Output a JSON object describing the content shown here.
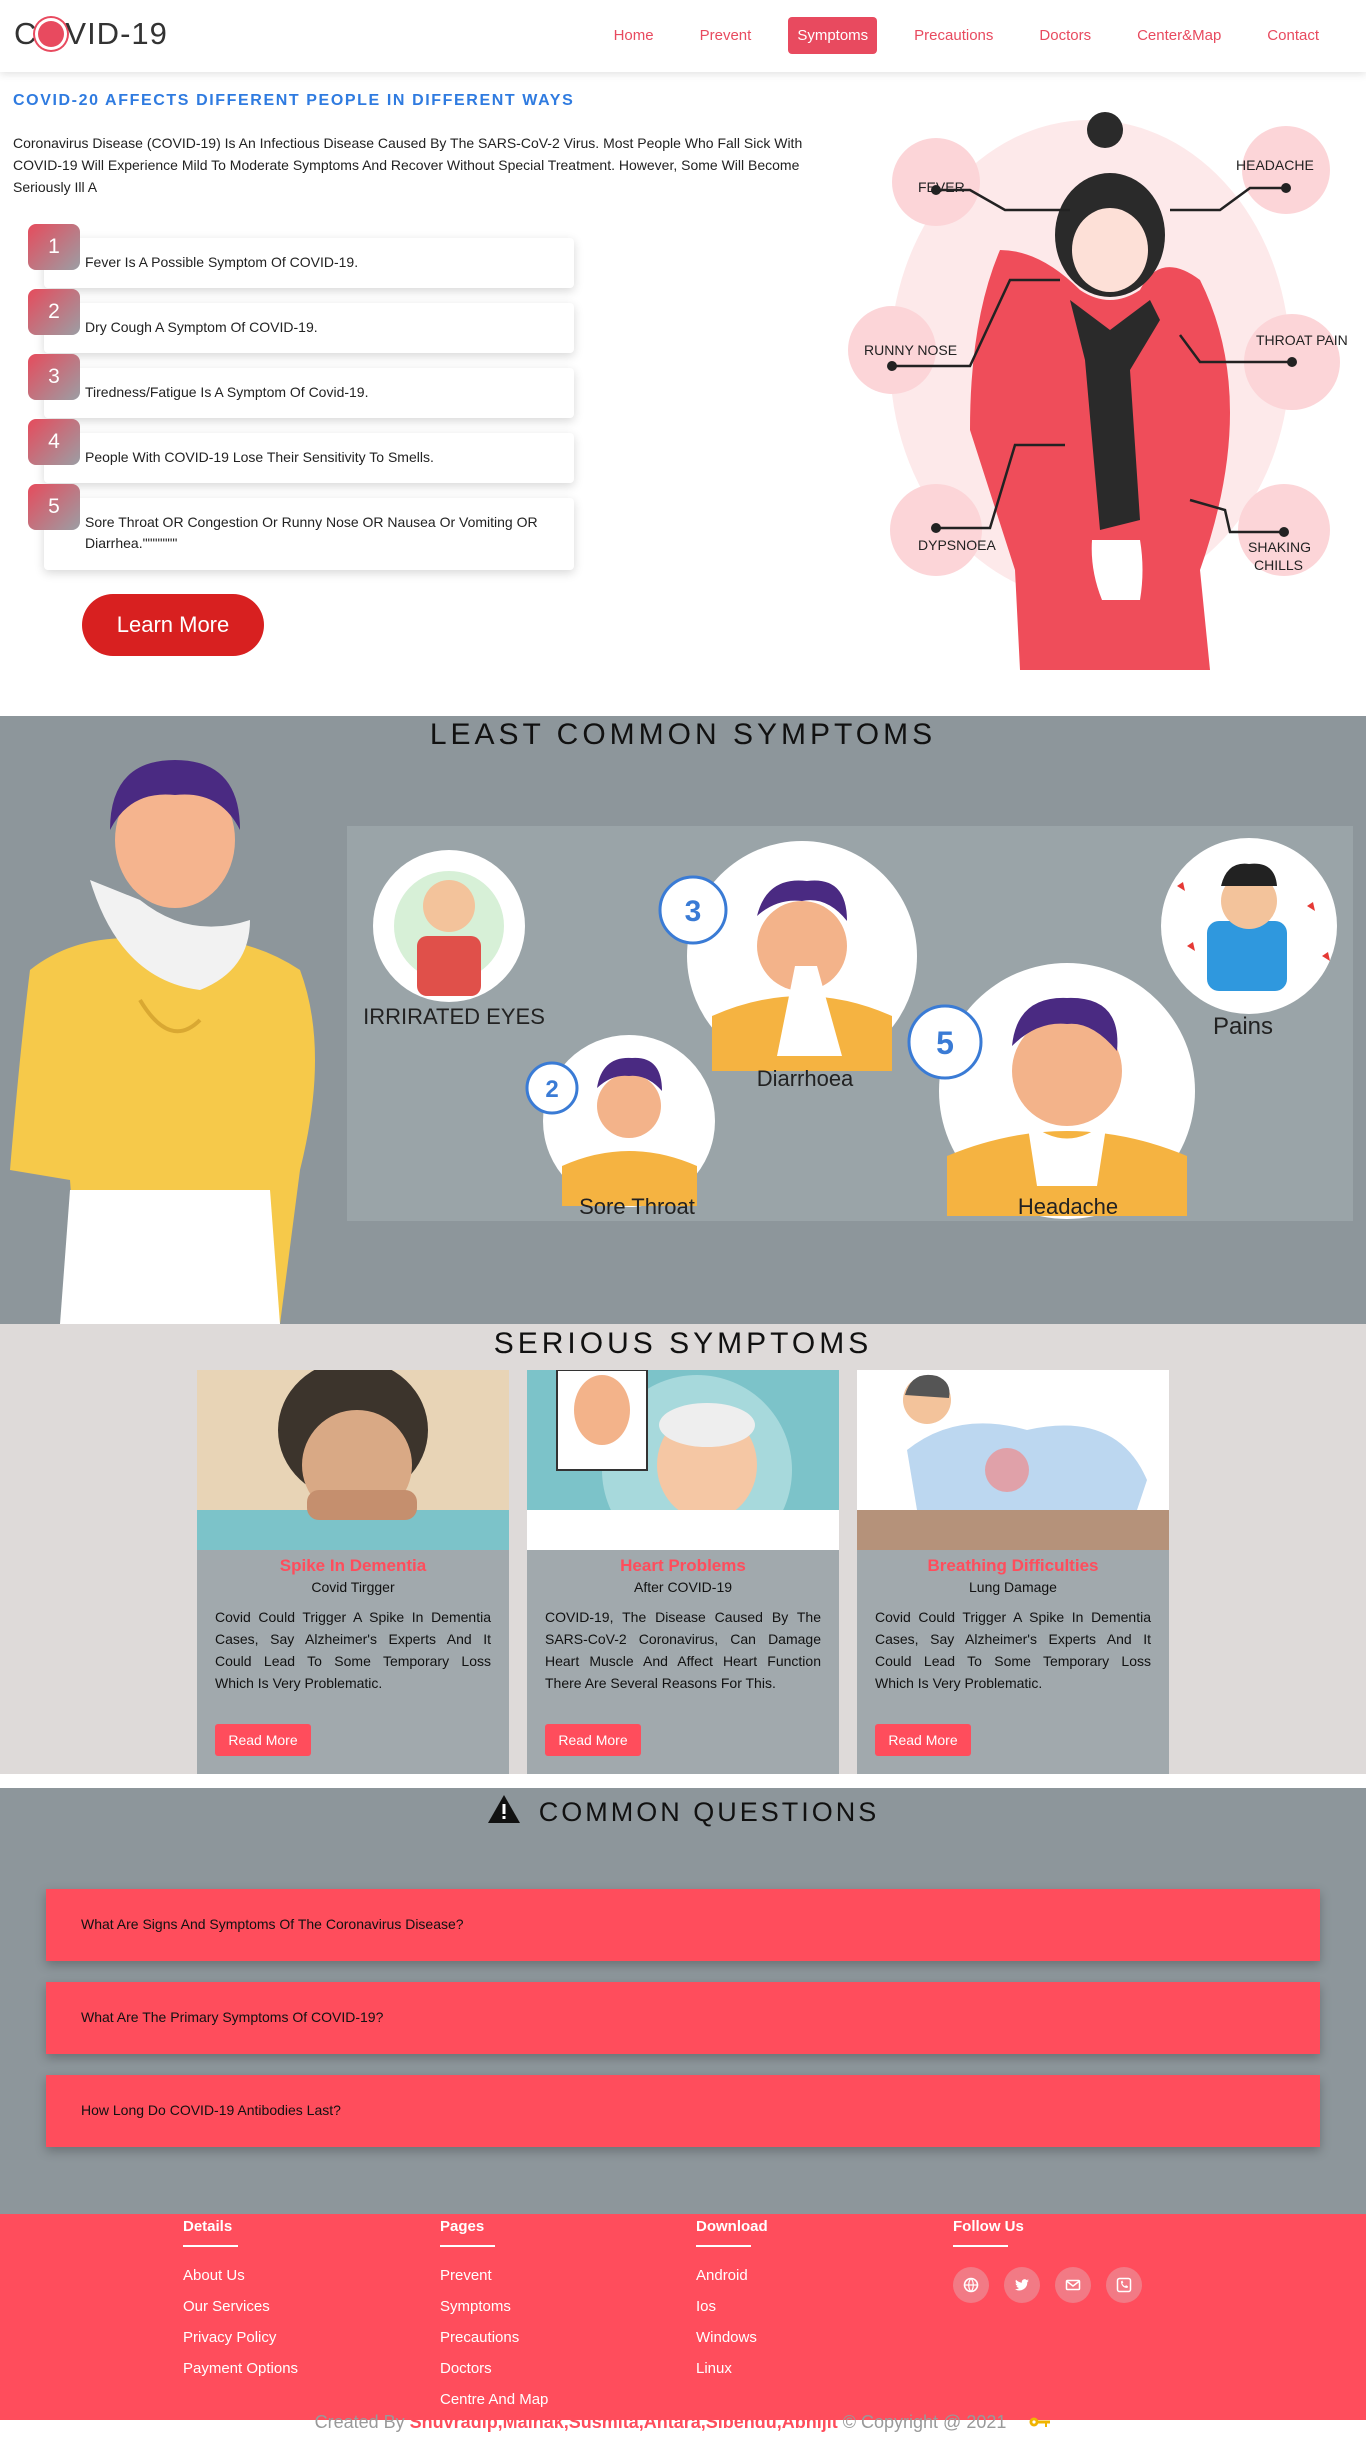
{
  "nav": {
    "logo": {
      "pre": "C",
      "post": "VID-19"
    },
    "items": [
      "Home",
      "Prevent",
      "Symptoms",
      "Precautions",
      "Doctors",
      "Center&Map",
      "Contact"
    ],
    "active_index": 2
  },
  "hero": {
    "heading": "COVID-20 AFFECTS DIFFERENT PEOPLE IN DIFFERENT WAYS",
    "intro": "Coronavirus Disease (COVID-19) Is An Infectious Disease Caused By The SARS-CoV-2 Virus. Most People Who Fall Sick With COVID-19 Will Experience Mild To Moderate Symptoms And Recover Without Special Treatment. However, Some Will Become Seriously Ill A",
    "symptoms": [
      {
        "num": "1",
        "text": "Fever Is A Possible Symptom Of COVID-19."
      },
      {
        "num": "2",
        "text": "Dry Cough A Symptom Of COVID-19."
      },
      {
        "num": "3",
        "text": "Tiredness/Fatigue Is A Symptom Of Covid-19."
      },
      {
        "num": "4",
        "text": "People With COVID-19 Lose Their Sensitivity To Smells."
      },
      {
        "num": "5",
        "text": "Sore Throat OR Congestion Or Runny Nose OR Nausea Or Vomiting OR Diarrhea.\"\"\"\"\"\"\""
      }
    ],
    "learn_more": "Learn More",
    "illustration_labels": [
      "FEVER",
      "HEADACHE",
      "RUNNY NOSE",
      "THROAT PAIN",
      "DYPSNOEA",
      "SHAKING",
      "CHILLS"
    ]
  },
  "least": {
    "title": "LEAST COMMON SYMPTOMS",
    "labels": [
      "IRRIRATED EYES",
      "Diarrhoea",
      "Sore Throat",
      "Headache",
      "Pains"
    ],
    "badges": [
      "3",
      "2",
      "5"
    ]
  },
  "serious": {
    "title": "SERIOUS SYMPTOMS",
    "cards": [
      {
        "title": "Spike In Dementia",
        "subtitle": "Covid Tirgger",
        "body": "Covid Could Trigger A Spike In Dementia Cases, Say Alzheimer's Experts And It Could Lead To Some Temporary Loss Which Is Very Problematic.",
        "button": "Read More"
      },
      {
        "title": "Heart Problems",
        "subtitle": "After COVID-19",
        "body": "COVID-19, The Disease Caused By The SARS-CoV-2 Coronavirus, Can Damage Heart Muscle And Affect Heart Function There Are Several Reasons For This.",
        "button": "Read More"
      },
      {
        "title": "Breathing Difficulties",
        "subtitle": "Lung Damage",
        "body": "Covid Could Trigger A Spike In Dementia Cases, Say Alzheimer's Experts And It Could Lead To Some Temporary Loss Which Is Very Problematic.",
        "button": "Read More"
      }
    ]
  },
  "questions": {
    "title": "COMMON QUESTIONS",
    "items": [
      "What Are Signs And Symptoms Of The Coronavirus Disease?",
      "What Are The Primary Symptoms Of COVID-19?",
      "How Long Do COVID-19 Antibodies Last?"
    ]
  },
  "footer": {
    "columns": [
      {
        "heading": "Details",
        "links": [
          "About Us",
          "Our Services",
          "Privacy Policy",
          "Payment Options"
        ]
      },
      {
        "heading": "Pages",
        "links": [
          "Prevent",
          "Symptoms",
          "Precautions",
          "Doctors",
          "Centre And Map"
        ]
      },
      {
        "heading": "Download",
        "links": [
          "Android",
          "Ios",
          "Windows",
          "Linux"
        ]
      },
      {
        "heading": "Follow Us",
        "links": []
      }
    ],
    "social_icons": [
      "globe-icon",
      "twitter-icon",
      "mail-icon",
      "phone-icon"
    ],
    "copyright": {
      "prefix": "Created By",
      "authors": "Shuvradip,Mainak,Susmita,Antara,Sibendu,Abhijit",
      "suffix": "© Copyright @ 2021"
    }
  }
}
